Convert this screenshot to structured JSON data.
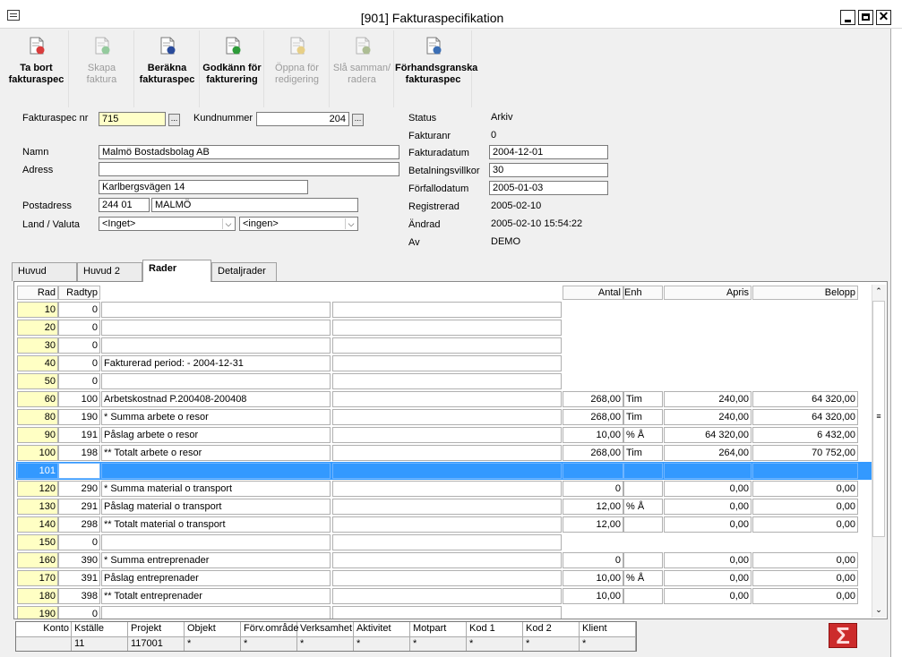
{
  "window": {
    "title": "[901]  Fakturaspecifikation"
  },
  "toolbar": [
    {
      "line1": "Ta bort",
      "line2": "fakturaspec",
      "enabled": true,
      "icon": "delete-doc-icon"
    },
    {
      "line1": "Skapa",
      "line2": "faktura",
      "enabled": false,
      "icon": "create-invoice-icon"
    },
    {
      "line1": "Beräkna",
      "line2": "fakturaspec",
      "enabled": true,
      "icon": "sigma-calc-icon"
    },
    {
      "line1": "Godkänn för",
      "line2": "fakturering",
      "enabled": true,
      "icon": "approve-doc-icon"
    },
    {
      "line1": "Öppna för",
      "line2": "redigering",
      "enabled": false,
      "icon": "open-edit-icon"
    },
    {
      "line1": "Slå samman/",
      "line2": "radera",
      "enabled": false,
      "icon": "merge-icon"
    },
    {
      "line1": "Förhandsgranska",
      "line2": "fakturaspec",
      "enabled": true,
      "icon": "preview-icon"
    }
  ],
  "form": {
    "fakturaspec_nr_label": "Fakturaspec nr",
    "fakturaspec_nr": "715",
    "kundnummer_label": "Kundnummer",
    "kundnummer": "204",
    "namn_label": "Namn",
    "namn": "Malmö Bostadsbolag AB",
    "adress_label": "Adress",
    "adress1": "",
    "adress2": "Karlbergsvägen 14",
    "postadress_label": "Postadress",
    "postnr": "244 01",
    "ort": "MALMÖ",
    "land_valuta_label": "Land / Valuta",
    "land": "<Inget>",
    "valuta": "<ingen>",
    "dots": "..."
  },
  "info": {
    "status_label": "Status",
    "status": "Arkiv",
    "fakturanr_label": "Fakturanr",
    "fakturanr": "0",
    "fakturadatum_label": "Fakturadatum",
    "fakturadatum": "2004-12-01",
    "betalningsvillkor_label": "Betalningsvillkor",
    "betalningsvillkor": "30",
    "forfallodatum_label": "Förfallodatum",
    "forfallodatum": "2005-01-03",
    "registrerad_label": "Registrerad",
    "registrerad": "2005-02-10",
    "andrad_label": "Ändrad",
    "andrad": "2005-02-10 15:54:22",
    "av_label": "Av",
    "av": "DEMO"
  },
  "tabs": [
    "Huvud",
    "Huvud 2",
    "Rader",
    "Detaljrader"
  ],
  "grid": {
    "headers": {
      "rad": "Rad",
      "radtyp": "Radtyp",
      "antal": "Antal",
      "enh": "Enh",
      "apris": "Apris",
      "belopp": "Belopp"
    },
    "rows": [
      {
        "rad": "10",
        "radtyp": "0",
        "text": "",
        "text2": "",
        "antal": null,
        "enh": null,
        "apris": null,
        "belopp": null
      },
      {
        "rad": "20",
        "radtyp": "0",
        "text": "",
        "text2": "",
        "antal": null,
        "enh": null,
        "apris": null,
        "belopp": null
      },
      {
        "rad": "30",
        "radtyp": "0",
        "text": "",
        "text2": "",
        "antal": null,
        "enh": null,
        "apris": null,
        "belopp": null
      },
      {
        "rad": "40",
        "radtyp": "0",
        "text": "Fakturerad period:  - 2004-12-31",
        "text2": "",
        "antal": null,
        "enh": null,
        "apris": null,
        "belopp": null
      },
      {
        "rad": "50",
        "radtyp": "0",
        "text": "",
        "text2": "",
        "antal": null,
        "enh": null,
        "apris": null,
        "belopp": null
      },
      {
        "rad": "60",
        "radtyp": "100",
        "text": "Arbetskostnad P.200408-200408",
        "text2": "",
        "antal": "268,00",
        "enh": "Tim",
        "apris": "240,00",
        "belopp": "64 320,00"
      },
      {
        "rad": "80",
        "radtyp": "190",
        "text": "* Summa arbete o resor",
        "text2": "",
        "antal": "268,00",
        "enh": "Tim",
        "apris": "240,00",
        "belopp": "64 320,00"
      },
      {
        "rad": "90",
        "radtyp": "191",
        "text": "Påslag arbete o resor",
        "text2": "",
        "antal": "10,00",
        "enh": "% Å",
        "apris": "64 320,00",
        "belopp": "6 432,00"
      },
      {
        "rad": "100",
        "radtyp": "198",
        "text": "** Totalt arbete o resor",
        "text2": "",
        "antal": "268,00",
        "enh": "Tim",
        "apris": "264,00",
        "belopp": "70 752,00"
      },
      {
        "rad": "101",
        "radtyp": "",
        "text": "",
        "text2": "",
        "antal": "",
        "enh": "",
        "apris": "",
        "belopp": "",
        "selected": true
      },
      {
        "rad": "120",
        "radtyp": "290",
        "text": "* Summa material o transport",
        "text2": "",
        "antal": "0",
        "enh": "",
        "apris": "0,00",
        "belopp": "0,00"
      },
      {
        "rad": "130",
        "radtyp": "291",
        "text": "Påslag material o transport",
        "text2": "",
        "antal": "12,00",
        "enh": "% Å",
        "apris": "0,00",
        "belopp": "0,00"
      },
      {
        "rad": "140",
        "radtyp": "298",
        "text": "** Totalt material o transport",
        "text2": "",
        "antal": "12,00",
        "enh": "",
        "apris": "0,00",
        "belopp": "0,00"
      },
      {
        "rad": "150",
        "radtyp": "0",
        "text": "",
        "text2": "",
        "antal": null,
        "enh": null,
        "apris": null,
        "belopp": null
      },
      {
        "rad": "160",
        "radtyp": "390",
        "text": "* Summa entreprenader",
        "text2": "",
        "antal": "0",
        "enh": "",
        "apris": "0,00",
        "belopp": "0,00"
      },
      {
        "rad": "170",
        "radtyp": "391",
        "text": "Påslag entreprenader",
        "text2": "",
        "antal": "10,00",
        "enh": "% Å",
        "apris": "0,00",
        "belopp": "0,00"
      },
      {
        "rad": "180",
        "radtyp": "398",
        "text": "** Totalt entreprenader",
        "text2": "",
        "antal": "10,00",
        "enh": "",
        "apris": "0,00",
        "belopp": "0,00"
      },
      {
        "rad": "190",
        "radtyp": "0",
        "text": "",
        "text2": "",
        "antal": null,
        "enh": null,
        "apris": null,
        "belopp": null
      }
    ]
  },
  "dimensions": {
    "headers": [
      "Konto",
      "Kställe",
      "Projekt",
      "Objekt",
      "Förv.område",
      "Verksamhet",
      "Aktivitet",
      "Motpart",
      "Kod 1",
      "Kod 2",
      "Klient"
    ],
    "values": [
      "",
      "11",
      "117001",
      "*",
      "*",
      "*",
      "*",
      "*",
      "*",
      "*",
      "*"
    ]
  },
  "sigma_button": "Σ"
}
